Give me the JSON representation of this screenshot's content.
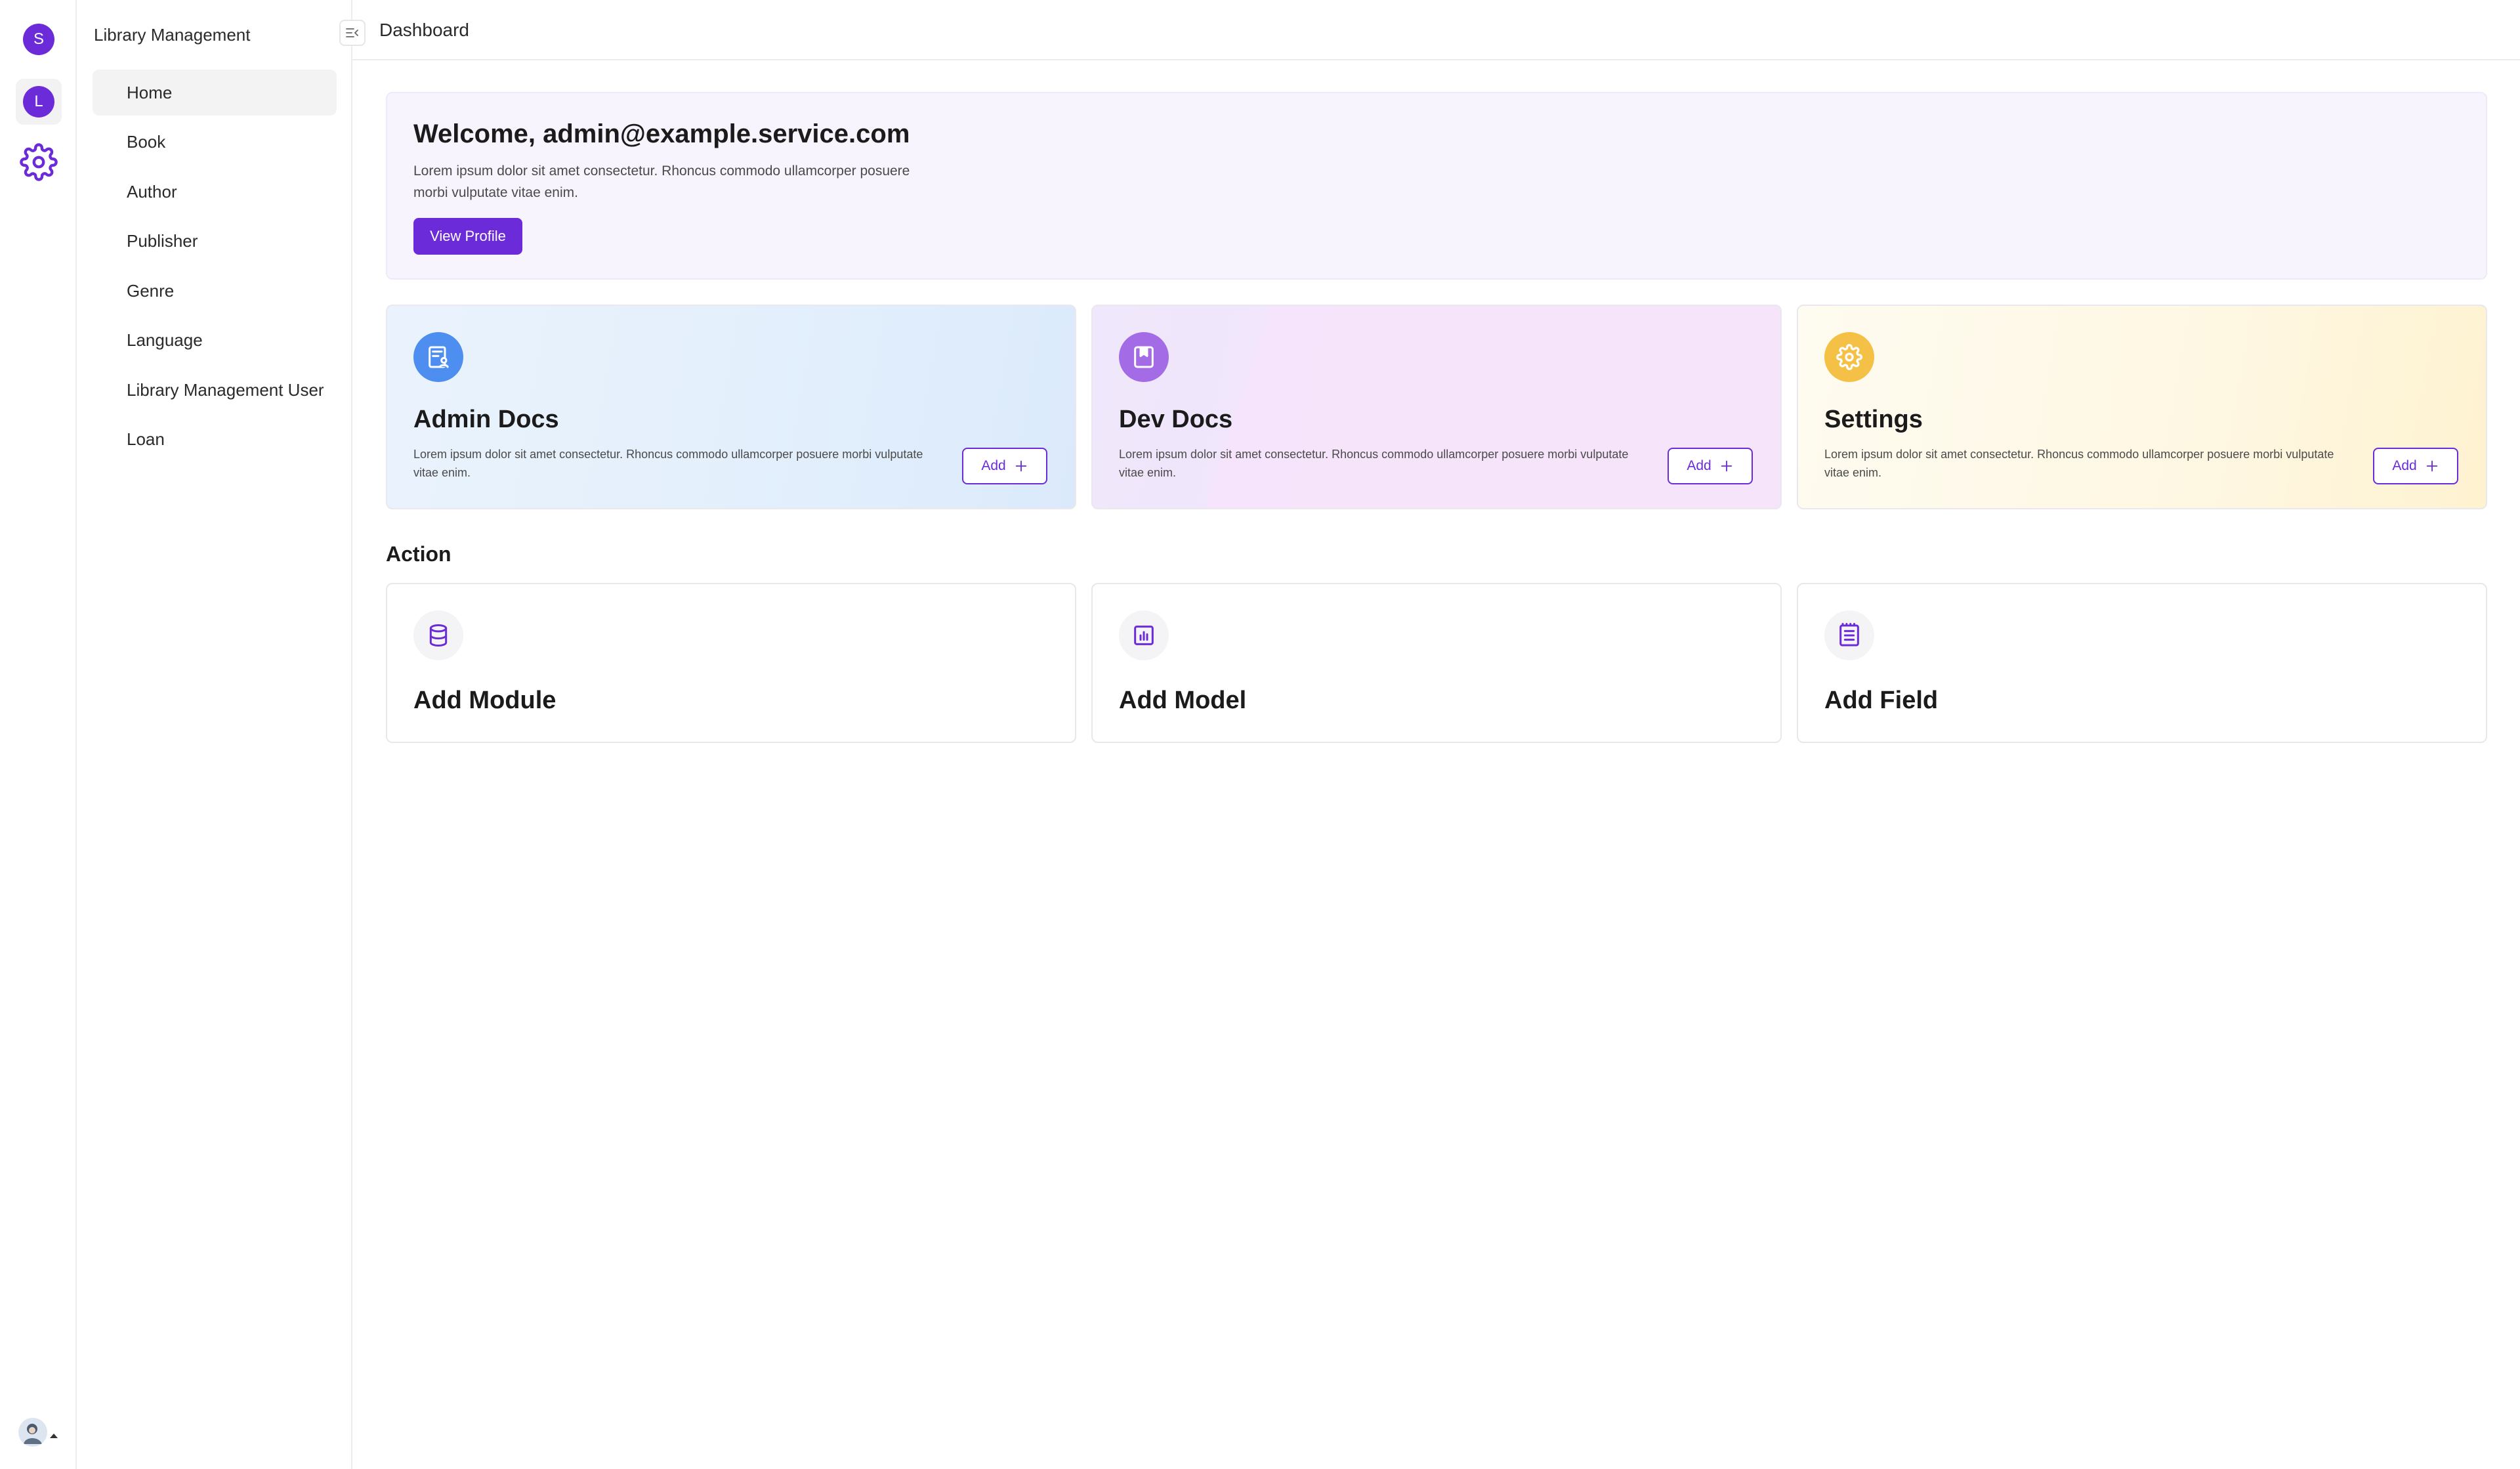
{
  "rail": {
    "workspace_initial": "S",
    "app_initial": "L",
    "settings_icon": "gear-icon",
    "user_icon": "user-avatar-icon"
  },
  "sidebar": {
    "app_title": "Library Management",
    "items": [
      {
        "label": "Home",
        "active": true
      },
      {
        "label": "Book"
      },
      {
        "label": "Author"
      },
      {
        "label": "Publisher"
      },
      {
        "label": "Genre"
      },
      {
        "label": "Language"
      },
      {
        "label": "Library Management User"
      },
      {
        "label": "Loan"
      }
    ]
  },
  "header": {
    "title": "Dashboard"
  },
  "welcome": {
    "heading": "Welcome, admin@example.service.com",
    "description": "Lorem ipsum dolor sit amet consectetur. Rhoncus commodo ullamcorper posuere morbi vulputate vitae enim.",
    "button_label": "View Profile"
  },
  "doc_cards": [
    {
      "title": "Admin Docs",
      "description": "Lorem ipsum dolor sit amet consectetur. Rhoncus commodo ullamcorper posuere morbi vulputate vitae enim.",
      "button_label": "Add",
      "icon": "document-user-icon",
      "icon_color": "#4d8ef0"
    },
    {
      "title": "Dev Docs",
      "description": "Lorem ipsum dolor sit amet consectetur. Rhoncus commodo ullamcorper posuere morbi vulputate vitae enim.",
      "button_label": "Add",
      "icon": "bookmark-icon",
      "icon_color": "#a36be6"
    },
    {
      "title": "Settings",
      "description": "Lorem ipsum dolor sit amet consectetur. Rhoncus commodo ullamcorper posuere morbi vulputate vitae enim.",
      "button_label": "Add",
      "icon": "gear-icon",
      "icon_color": "#f5c046"
    }
  ],
  "action": {
    "title": "Action",
    "items": [
      {
        "label": "Add Module",
        "icon": "database-icon"
      },
      {
        "label": "Add Model",
        "icon": "chart-icon"
      },
      {
        "label": "Add Field",
        "icon": "list-icon"
      }
    ]
  },
  "colors": {
    "accent": "#6c2bd9"
  }
}
